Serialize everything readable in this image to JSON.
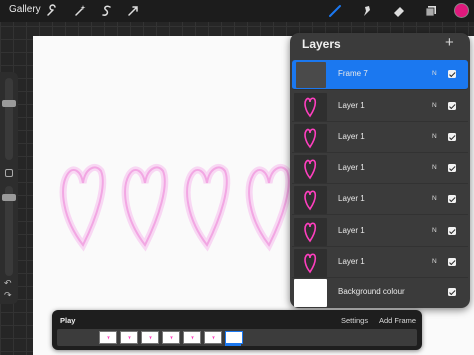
{
  "toolbar": {
    "gallery_label": "Gallery",
    "left_tools": [
      "wrench-icon",
      "magic-wand-icon",
      "selection-icon",
      "transform-icon"
    ],
    "right_tools": [
      "brush-icon",
      "smudge-icon",
      "eraser-icon",
      "layers-icon"
    ],
    "active_tool": "brush-icon",
    "active_color": "#e0197d"
  },
  "layers": {
    "title": "Layers",
    "add_label": "+",
    "items": [
      {
        "name": "Frame 7",
        "mode": "N",
        "selected": true
      },
      {
        "name": "Layer 1",
        "mode": "N",
        "selected": false
      },
      {
        "name": "Layer 1",
        "mode": "N",
        "selected": false
      },
      {
        "name": "Layer 1",
        "mode": "N",
        "selected": false
      },
      {
        "name": "Layer 1",
        "mode": "N",
        "selected": false
      },
      {
        "name": "Layer 1",
        "mode": "N",
        "selected": false
      },
      {
        "name": "Layer 1",
        "mode": "N",
        "selected": false
      }
    ],
    "background": {
      "name": "Background colour"
    }
  },
  "animation": {
    "play_label": "Play",
    "settings_label": "Settings",
    "add_frame_label": "Add Frame",
    "frame_count": 7,
    "current_frame": 7
  },
  "colors": {
    "selection_blue": "#1b78f0",
    "heart_pink": "#ff3fbf",
    "glow_pink": "#f7b6ea"
  }
}
